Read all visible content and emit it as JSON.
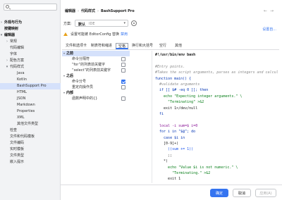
{
  "sidebar": {
    "search_placeholder": "",
    "items": [
      {
        "label": "外观与行为",
        "bold": true,
        "chevron": "right"
      },
      {
        "label": "按键映射",
        "bold": true,
        "chevron": ""
      },
      {
        "label": "编辑器",
        "bold": true,
        "chevron": "down"
      },
      {
        "label": "常规",
        "bold": false,
        "chevron": "right"
      },
      {
        "label": "代码编辑",
        "bold": false,
        "chevron": ""
      },
      {
        "label": "字体",
        "bold": false,
        "chevron": ""
      },
      {
        "label": "配色方案",
        "bold": false,
        "chevron": "right"
      },
      {
        "label": "代码样式",
        "bold": false,
        "chevron": "down"
      },
      {
        "label": "Java",
        "bold": false,
        "chevron": ""
      },
      {
        "label": "Kotlin",
        "bold": false,
        "chevron": ""
      },
      {
        "label": "BashSupport Pro",
        "bold": false,
        "chevron": "",
        "selected": true
      },
      {
        "label": "HTML",
        "bold": false,
        "chevron": ""
      },
      {
        "label": "JSON",
        "bold": false,
        "chevron": ""
      },
      {
        "label": "Markdown",
        "bold": false,
        "chevron": ""
      },
      {
        "label": "Properties",
        "bold": false,
        "chevron": ""
      },
      {
        "label": "XML",
        "bold": false,
        "chevron": ""
      },
      {
        "label": "其他文件类型",
        "bold": false,
        "chevron": ""
      },
      {
        "label": "检查",
        "bold": false,
        "chevron": ""
      },
      {
        "label": "文件和代码模板",
        "bold": false,
        "chevron": ""
      },
      {
        "label": "文件编码",
        "bold": false,
        "chevron": ""
      },
      {
        "label": "实时模板",
        "bold": false,
        "chevron": ""
      },
      {
        "label": "文件类型",
        "bold": false,
        "chevron": ""
      },
      {
        "label": "嵌入提示",
        "bold": false,
        "chevron": ""
      }
    ]
  },
  "header": {
    "breadcrumb": [
      "编辑器",
      "代码样式",
      "BashSupport Pro"
    ],
    "back_arrow": "←",
    "forward_arrow": "→"
  },
  "scheme": {
    "label": "方案:",
    "value": "默认",
    "scope": "IDE",
    "set_from_link": "设置自..."
  },
  "warning": {
    "text": "设置可能被 EditorConfig 替换",
    "link": "禁用"
  },
  "tabs": [
    "文件和选项卡",
    "制表符和缩进",
    "空格",
    "换行和大括号",
    "空行",
    "其他"
  ],
  "active_tab": "空格",
  "options": [
    {
      "label": "之前",
      "type": "group",
      "selected": true
    },
    {
      "label": "命令分隔符",
      "type": "child",
      "checked": false
    },
    {
      "label": "“for”的列表前关键字",
      "type": "child",
      "checked": false
    },
    {
      "label": "“select”的列表前关键字",
      "type": "child",
      "checked": false
    },
    {
      "label": "之后",
      "type": "group"
    },
    {
      "label": "命令分号",
      "type": "child",
      "checked": true
    },
    {
      "label": "重定向操作员",
      "type": "child",
      "checked": false
    },
    {
      "label": "内部",
      "type": "group"
    },
    {
      "label": "函数声明中的{}",
      "type": "child",
      "checked": false
    }
  ],
  "code_lines": [
    {
      "t": "#!/usr/bin/env bash",
      "c": "c-bold",
      "y": 0
    },
    {
      "t": "",
      "c": "c-def",
      "y": 1
    },
    {
      "t": "#Entry points.",
      "c": "c-cm",
      "y": 2
    },
    {
      "t": "#Takes the script arguments, parses as integers and calcul",
      "c": "c-cm",
      "y": 3
    },
    {
      "t": "function main() {",
      "c": "c-kw",
      "y": 4
    },
    {
      "t": "  #validate arguments",
      "c": "c-cm",
      "y": 5
    },
    {
      "t": "  if [[ $# -eq 0 ]]; then",
      "c": "c-kw",
      "y": 6
    },
    {
      "t": "    echo \"Expecting integer arguments.\" \\",
      "c": "c-str",
      "y": 7
    },
    {
      "t": "      \"Terminating\" >&2",
      "c": "c-str",
      "y": 8
    },
    {
      "t": "    exit 1>/dev/null",
      "c": "c-def",
      "y": 9
    },
    {
      "t": "  fi",
      "c": "c-kw",
      "y": 10
    },
    {
      "t": "",
      "c": "c-def",
      "y": 11
    },
    {
      "t": "  local -i sum=$ i=0",
      "c": "c-var",
      "y": 12
    },
    {
      "t": "  for i in \"$@\"; do",
      "c": "c-kw",
      "y": 13
    },
    {
      "t": "    case $i in",
      "c": "c-kw",
      "y": 14
    },
    {
      "t": "    [0-9]+)",
      "c": "c-def",
      "y": 15
    },
    {
      "t": "      ((sum += 1))",
      "c": "c-num",
      "y": 16
    },
    {
      "t": "      ;;",
      "c": "c-def",
      "y": 17
    },
    {
      "t": "    *)",
      "c": "c-def",
      "y": 18
    },
    {
      "t": "      echo \"Value $i is not numeric.\" \\",
      "c": "c-str",
      "y": 19
    },
    {
      "t": "        \"Terminating.\" >&2",
      "c": "c-str",
      "y": 20
    },
    {
      "t": "      exit 1",
      "c": "c-def",
      "y": 21
    }
  ],
  "footer": {
    "ok": "确定",
    "cancel": "取消",
    "apply": "应用(A)"
  },
  "colors": {
    "accent": "#3574f0",
    "warning": "#e8a21b",
    "selected_bg": "#d5e1fb"
  }
}
